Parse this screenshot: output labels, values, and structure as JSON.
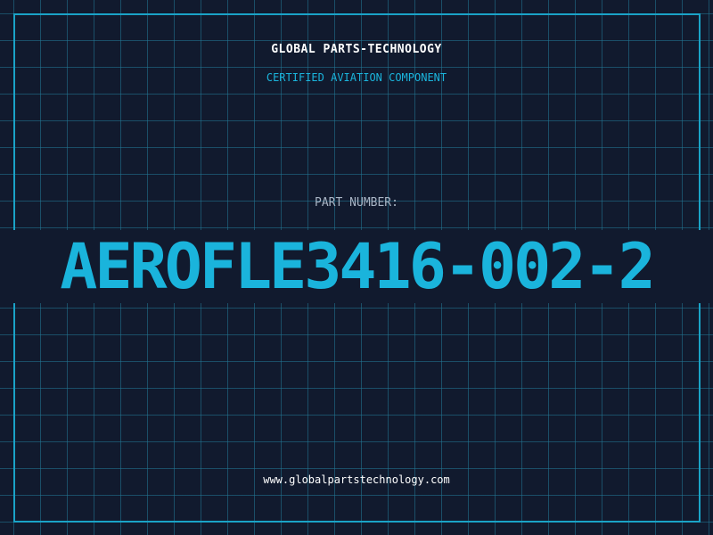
{
  "colors": {
    "background": "#111a2e",
    "grid": "#1f6f8a",
    "accent": "#1ab4dc",
    "frame": "#1aa3c7",
    "label": "#a8b4c4",
    "text": "#ffffff"
  },
  "label": {
    "brand": "GLOBAL PARTS-TECHNOLOGY",
    "subtitle": "CERTIFIED AVIATION COMPONENT",
    "part_label": "PART NUMBER:",
    "part_number": "AEROFLE3416-002-2",
    "website": "www.globalpartstechnology.com"
  }
}
